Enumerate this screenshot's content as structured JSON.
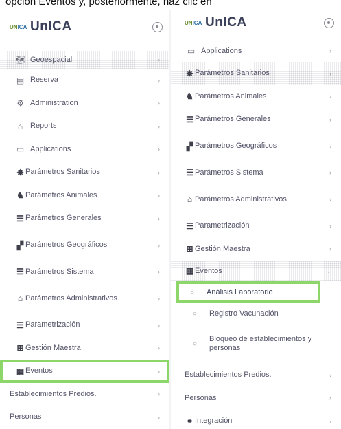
{
  "caption": "opción Eventos y, posteriormente, haz clic en",
  "brand": {
    "logo": "UNICA",
    "title": "UnICA"
  },
  "left_menu": [
    {
      "label": "Geoespacial",
      "icon": "map-icon"
    },
    {
      "label": "Reserva",
      "icon": "book-icon"
    },
    {
      "label": "Administration",
      "icon": "gear-icon"
    },
    {
      "label": "Reports",
      "icon": "chart-icon"
    },
    {
      "label": "Applications",
      "icon": "monitor-icon"
    },
    {
      "label": "Parámetros Sanitarios",
      "icon": "virus-icon"
    },
    {
      "label": "Parámetros Animales",
      "icon": "cattle-icon"
    },
    {
      "label": "Parámetros Generales",
      "icon": "list-icon"
    },
    {
      "label": "Parámetros Geográficos",
      "icon": "region-icon"
    },
    {
      "label": "Parámetros Sistema",
      "icon": "list-icon"
    },
    {
      "label": "Parámetros Administrativos",
      "icon": "building-icon"
    },
    {
      "label": "Parametrización",
      "icon": "list-icon"
    },
    {
      "label": "Gestión Maestra",
      "icon": "table-icon"
    },
    {
      "label": "Eventos",
      "icon": "calendar-icon"
    },
    {
      "label": "Establecimientos Predios.",
      "icon": ""
    },
    {
      "label": "Personas",
      "icon": ""
    }
  ],
  "right_menu": [
    {
      "label": "Applications",
      "icon": "monitor-icon"
    },
    {
      "label": "Parámetros Sanitarios",
      "icon": "virus-icon"
    },
    {
      "label": "Parámetros Animales",
      "icon": "cattle-icon"
    },
    {
      "label": "Parámetros Generales",
      "icon": "list-icon"
    },
    {
      "label": "Parámetros Geográficos",
      "icon": "region-icon"
    },
    {
      "label": "Parámetros Sistema",
      "icon": "list-icon"
    },
    {
      "label": "Parámetros Administrativos",
      "icon": "building-icon"
    },
    {
      "label": "Parametrización",
      "icon": "list-icon"
    },
    {
      "label": "Gestión Maestra",
      "icon": "table-icon"
    },
    {
      "label": "Eventos",
      "icon": "calendar-icon"
    }
  ],
  "eventos_submenu": [
    {
      "label": "Análisis Laboratorio"
    },
    {
      "label": "Registro Vacunación"
    },
    {
      "label": "Bloqueo de establecimientos y personas"
    }
  ],
  "right_tail": [
    {
      "label": "Establecimientos Predios."
    },
    {
      "label": "Personas"
    },
    {
      "label": "Integración"
    }
  ],
  "colors": {
    "highlight": "#8cd66a",
    "logo_green": "#6b8e2f",
    "logo_blue": "#2d6fa8"
  }
}
